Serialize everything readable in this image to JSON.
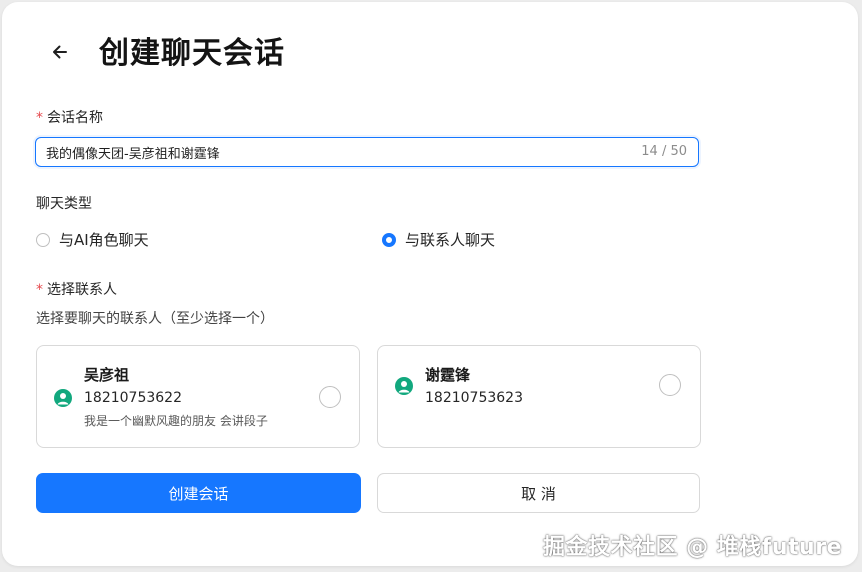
{
  "header": {
    "title": "创建聊天会话"
  },
  "form": {
    "name_label": "会话名称",
    "name_value": "我的偶像天团-吴彦祖和谢霆锋",
    "name_count": "14 / 50",
    "type_label": "聊天类型",
    "type_options": [
      {
        "label": "与AI角色聊天",
        "checked": false
      },
      {
        "label": "与联系人聊天",
        "checked": true
      }
    ],
    "contacts_label": "选择联系人",
    "contacts_hint": "选择要聊天的联系人（至少选择一个）",
    "contacts": [
      {
        "name": "吴彦祖",
        "phone": "18210753622",
        "desc": "我是一个幽默风趣的朋友 会讲段子",
        "selected": false
      },
      {
        "name": "谢霆锋",
        "phone": "18210753623",
        "desc": "",
        "selected": false
      }
    ]
  },
  "actions": {
    "create_label": "创建会话",
    "cancel_label": "取 消"
  },
  "watermark": "掘金技术社区 @ 堆栈future",
  "colors": {
    "primary": "#1677ff",
    "required": "#e5484d",
    "avatar": "#12a87e"
  },
  "icons": {
    "back": "arrow-left-icon",
    "avatar": "user-avatar-icon"
  }
}
